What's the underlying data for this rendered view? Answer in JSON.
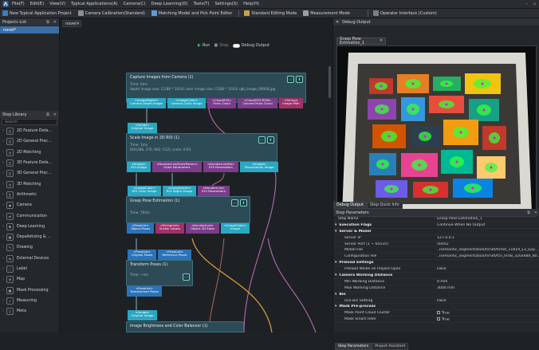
{
  "menu": {
    "items": [
      "File(F)",
      "Edit(E)",
      "View(V)",
      "Typical Applications(A)",
      "Camera(C)",
      "Deep Learning(D)",
      "Tools(T)",
      "Settings(S)",
      "Help(H)"
    ]
  },
  "toolbar": {
    "new_project": "New Typical Application Project",
    "calibration": "Camera Calibration(Standard)",
    "matching": "Matching Model and Pick Point Editor",
    "editing_mode": "Standard Editing Mode",
    "measurement": "Measurement Mode",
    "operator_iface": "Operator Interface (Custom)"
  },
  "projects": {
    "title": "Projects List",
    "item": "novel*"
  },
  "library": {
    "title": "Step Library",
    "search": "Search",
    "items": [
      "2D Feature Dete...",
      "2D General Proc...",
      "2D Matching",
      "3D Feature Dete...",
      "3D General Proc...",
      "3D Matching",
      "Arithmetic",
      "Camera",
      "Communication",
      "Deep Learning",
      "Depalletizing & ...",
      "Drawing",
      "External Devices",
      "Label",
      "Map",
      "Mask Processing",
      "Measuring",
      "Meta"
    ]
  },
  "canvas": {
    "tab": "novel",
    "run": "Run",
    "stop": "Stop",
    "debug_output": "Debug Output",
    "nodes": {
      "capture": {
        "title": "Capture Images from Camera (1)",
        "time": "Time: 0ms",
        "info": "depth image size: (1280 * 1024) color image size: (1280 * 1024) rgb_image_00008.jpg",
        "ports": [
          "<ImageDepth>\nCamera Depth Image",
          "<ImageColor>\nCamera Color Image",
          "<CloudXYZ>\nPoint Cloud",
          "<CloudXYZ-RGB>\nColored Point Cloud",
          "<String>\nImage Path"
        ]
      },
      "scale_in": {
        "port": "<Image>\nOriginal Image"
      },
      "scale": {
        "title": "Scale Image in 2D ROI (1)",
        "time": "Time: 1ms",
        "info": "ROI(286, 270, 662, 512), scale: 0.93",
        "ports": [
          "<Image>\nROI Image",
          "<NumberList/ScaleParam>\nScale Parameters",
          "<NumberList/Ro>\nROI Parameters",
          "<Image>\nVisualization Image"
        ]
      },
      "grasp_in": {
        "ports": [
          "<ImageColor>\nROI Color Image",
          "<ImageDepth>\nROI Depth Image",
          "<NumberList>\nROI Parameters"
        ]
      },
      "grasp": {
        "title": "Grasp Pose Estimation (1)",
        "time": "Time: 76ms",
        "ports": [
          "<PoseList>\nObject Poses",
          "<StringList>\nSucker Labels",
          "<NumberList>\nObject 3D Sizes",
          "<ImageColor>\nImage"
        ]
      },
      "transform_in": {
        "ports": [
          "<PoseList>\nOriginal Poses",
          "<PoseList>\nReference Poses"
        ]
      },
      "transform": {
        "title": "Transform Poses (1)",
        "time": "Time: ~ms"
      },
      "transform_out": {
        "port": "<PoseList>\nTransformed Poses"
      },
      "bright_in": {
        "port": "<Image>\nOriginal Image"
      },
      "bright": {
        "title": "Image Brightness and Color Balancer (1)"
      }
    }
  },
  "debug": {
    "title": "Debug Output",
    "image_tab": "Grasp Pose Estimation_1",
    "tabs": [
      "Debug Output",
      "Step Quick Info"
    ],
    "params_title": "Step Parameters",
    "rows": [
      {
        "k": "Step Name",
        "v": "Grasp Pose Estimation_1",
        "t": "row"
      },
      {
        "k": "Execution Flags",
        "v": "Continue When No Output",
        "t": "sec"
      },
      {
        "k": "Server & Model",
        "v": "",
        "t": "sec"
      },
      {
        "k": "Server IP",
        "v": "127.0.0.1",
        "t": "sub"
      },
      {
        "k": "Server Port (1 ~ 65535)",
        "v": "50052",
        "t": "sub"
      },
      {
        "k": "Model File",
        "v": "../semantic_segmentation/hrnet/hrnet_11819_L3_o2p...",
        "t": "sub"
      },
      {
        "k": "Configuration File",
        "v": "../semantic_segmentation/hrnet/fcn_hr48_320x480_80...",
        "t": "sub"
      },
      {
        "k": "Preload Settings",
        "v": "",
        "t": "sec"
      },
      {
        "k": "Preload Model on Project Open",
        "v": "False",
        "t": "sub"
      },
      {
        "k": "Camera Working Distance",
        "v": "",
        "t": "sec"
      },
      {
        "k": "Min Working Distance",
        "v": "0 mm",
        "t": "sub"
      },
      {
        "k": "Max Working Distance",
        "v": "3000 mm",
        "t": "sub"
      },
      {
        "k": "Bin",
        "v": "",
        "t": "sec"
      },
      {
        "k": "Use Bin Setting",
        "v": "False",
        "t": "sub"
      },
      {
        "k": "Mask Pre-process",
        "v": "",
        "t": "sec"
      },
      {
        "k": "Mask Point Cloud Cluster",
        "v": "True",
        "t": "sub"
      },
      {
        "k": "Mask Smart Filter",
        "v": "True",
        "t": "sub"
      }
    ],
    "bottom_tabs": [
      "Step Parameters",
      "Project Assistant"
    ]
  },
  "colors": {
    "accent": "#3a6ea5",
    "node": "#2c4b57",
    "port_cyan": "#2aa8c2",
    "port_blue": "#2b73b8",
    "port_purple": "#7b3c8a",
    "port_magenta": "#a0306a"
  }
}
